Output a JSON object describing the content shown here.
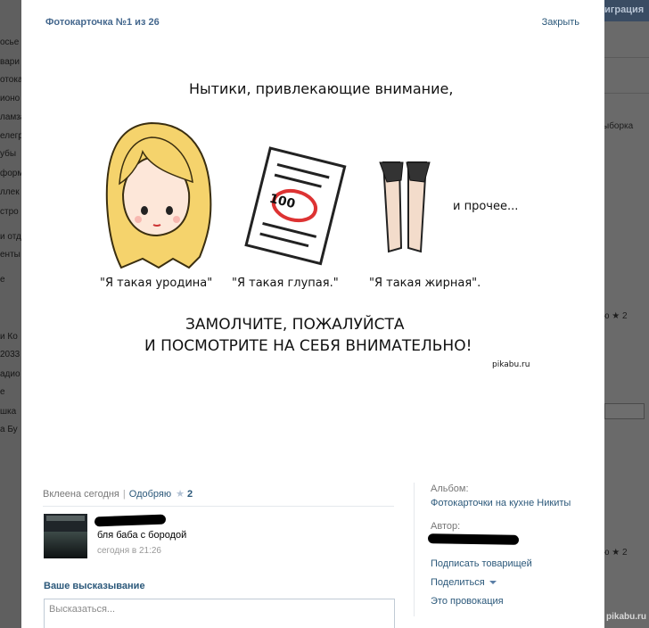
{
  "background": {
    "top_label": "играция",
    "left_items": [
      "осье",
      "вари",
      "отока",
      "ионо",
      "ламза",
      "елегр",
      "убы",
      "форм",
      "ллек",
      "стро",
      "и отд",
      "енты",
      "е",
      "и Ко",
      "2033",
      "адио",
      "е",
      "шка",
      "а Бу"
    ],
    "right_items": [
      "ыборка",
      "ю ★ 2",
      "ю ★ 2"
    ],
    "watermark": "pikabu.ru"
  },
  "header": {
    "title": "Фотокарточка №1 из 26",
    "close_label": "Закрыть"
  },
  "photo": {
    "title": "Нытики, привлекающие внимание,",
    "captions": [
      "\"Я такая уродина\"",
      "\"Я такая глупая.\"",
      "\"Я такая жирная\"."
    ],
    "and_more": "и прочее...",
    "test_score": "100",
    "bottom_line1": "ЗАМОЛЧИТЕ, ПОЖАЛУЙСТА",
    "bottom_line2": "И ПОСМОТРИТЕ НА СЕБЯ ВНИМАТЕЛЬНО!",
    "watermark": "pikabu.ru"
  },
  "info": {
    "added": "Вклеена сегодня",
    "like_label": "Одобряю",
    "like_count": "2"
  },
  "comment": {
    "text": "бля баба с бородой",
    "time": "сегодня в 21:26"
  },
  "compose": {
    "heading": "Ваше высказывание",
    "placeholder": "Высказаться..."
  },
  "sidebar": {
    "album_label": "Альбом:",
    "album_name": "Фотокарточки на кухне Никиты",
    "author_label": "Автор:",
    "tag_friend": "Подписать товарищей",
    "share": "Поделиться",
    "report": "Это провокация"
  },
  "colors": {
    "link": "#2b587a",
    "title": "#45688e",
    "overlay": "#6b6b6b",
    "hair": "#f5d36c"
  }
}
